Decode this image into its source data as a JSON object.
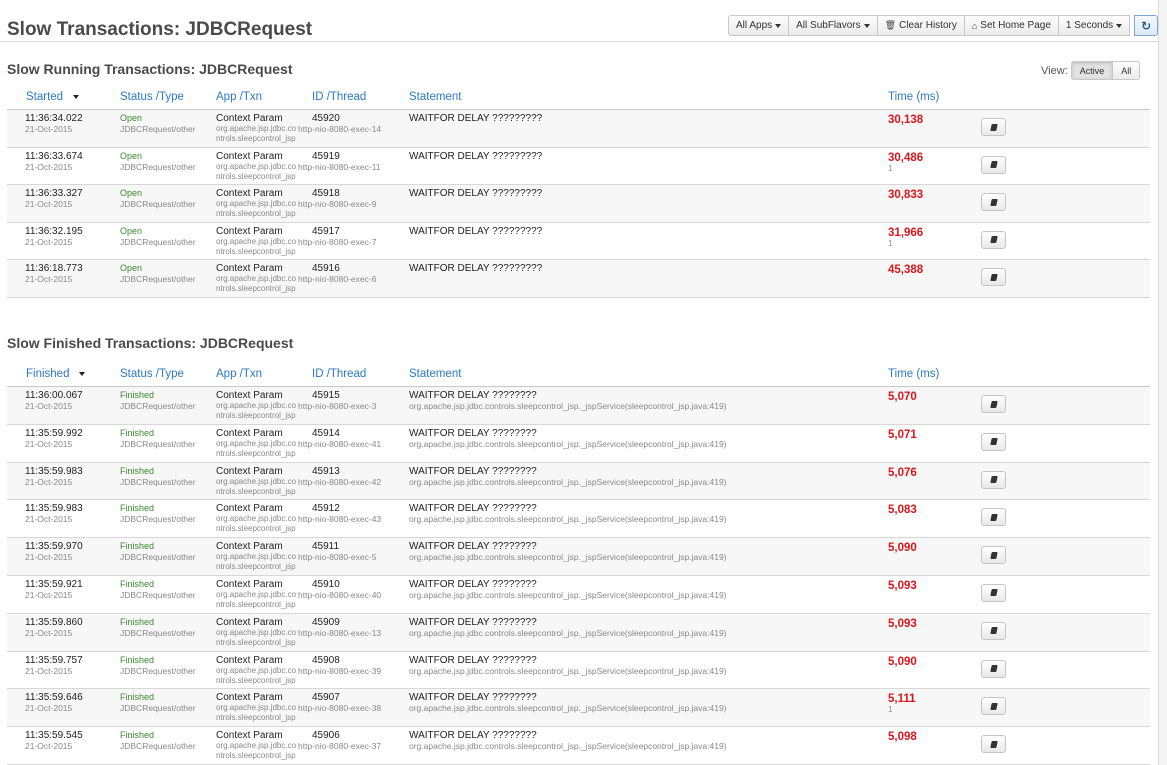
{
  "header": {
    "title": "Slow Transactions: JDBCRequest",
    "toolbar": {
      "apps_label": "All Apps",
      "subflavors_label": "All SubFlavors",
      "clear_label": "Clear History",
      "home_label": "Set Home Page",
      "interval_label": "1 Seconds"
    }
  },
  "running": {
    "title": "Slow Running Transactions: JDBCRequest",
    "view_label": "View:",
    "view_options": [
      "Active",
      "All"
    ],
    "columns": [
      "Started",
      "Status /Type",
      "App /Txn",
      "ID /Thread",
      "Statement",
      "Time (ms)"
    ],
    "rows": [
      {
        "time": "11:36:34.022",
        "date": "21-Oct-2015",
        "status": "Open",
        "type": "JDBCRequest/other",
        "app": "Context Param",
        "txn": "org.apache.jsp.jdbc.controls.sleepcontrol_jsp",
        "id": "45920",
        "thread": "http-nio-8080-exec-14",
        "statement": "WAITFOR DELAY ?????????",
        "ms": "30,138",
        "sub": ""
      },
      {
        "time": "11:36:33.674",
        "date": "21-Oct-2015",
        "status": "Open",
        "type": "JDBCRequest/other",
        "app": "Context Param",
        "txn": "org.apache.jsp.jdbc.controls.sleepcontrol_jsp",
        "id": "45919",
        "thread": "http-nio-8080-exec-11",
        "statement": "WAITFOR DELAY ?????????",
        "ms": "30,486",
        "sub": "1"
      },
      {
        "time": "11:36:33.327",
        "date": "21-Oct-2015",
        "status": "Open",
        "type": "JDBCRequest/other",
        "app": "Context Param",
        "txn": "org.apache.jsp.jdbc.controls.sleepcontrol_jsp",
        "id": "45918",
        "thread": "http-nio-8080-exec-9",
        "statement": "WAITFOR DELAY ?????????",
        "ms": "30,833",
        "sub": ""
      },
      {
        "time": "11:36:32.195",
        "date": "21-Oct-2015",
        "status": "Open",
        "type": "JDBCRequest/other",
        "app": "Context Param",
        "txn": "org.apache.jsp.jdbc.controls.sleepcontrol_jsp",
        "id": "45917",
        "thread": "http-nio-8080-exec-7",
        "statement": "WAITFOR DELAY ?????????",
        "ms": "31,966",
        "sub": "1"
      },
      {
        "time": "11:36:18.773",
        "date": "21-Oct-2015",
        "status": "Open",
        "type": "JDBCRequest/other",
        "app": "Context Param",
        "txn": "org.apache.jsp.jdbc.controls.sleepcontrol_jsp",
        "id": "45916",
        "thread": "http-nio-8080-exec-6",
        "statement": "WAITFOR DELAY ?????????",
        "ms": "45,388",
        "sub": ""
      }
    ]
  },
  "finished": {
    "title": "Slow Finished Transactions: JDBCRequest",
    "columns": [
      "Finished",
      "Status /Type",
      "App /Txn",
      "ID /Thread",
      "Statement",
      "Time (ms)"
    ],
    "rows": [
      {
        "time": "11:36:00.067",
        "date": "21-Oct-2015",
        "status": "Finished",
        "type": "JDBCRequest/other",
        "app": "Context Param",
        "txn": "org.apache.jsp.jdbc.controls.sleepcontrol_jsp",
        "id": "45915",
        "thread": "http-nio-8080-exec-3",
        "statement": "WAITFOR DELAY ????????",
        "stack": "org.apache.jsp.jdbc.controls.sleepcontrol_jsp._jspService(sleepcontrol_jsp.java:419)",
        "ms": "5,070",
        "sub": ""
      },
      {
        "time": "11:35:59.992",
        "date": "21-Oct-2015",
        "status": "Finished",
        "type": "JDBCRequest/other",
        "app": "Context Param",
        "txn": "org.apache.jsp.jdbc.controls.sleepcontrol_jsp",
        "id": "45914",
        "thread": "http-nio-8080-exec-41",
        "statement": "WAITFOR DELAY ????????",
        "stack": "org.apache.jsp.jdbc.controls.sleepcontrol_jsp._jspService(sleepcontrol_jsp.java:419)",
        "ms": "5,071",
        "sub": ""
      },
      {
        "time": "11:35:59.983",
        "date": "21-Oct-2015",
        "status": "Finished",
        "type": "JDBCRequest/other",
        "app": "Context Param",
        "txn": "org.apache.jsp.jdbc.controls.sleepcontrol_jsp",
        "id": "45913",
        "thread": "http-nio-8080-exec-42",
        "statement": "WAITFOR DELAY ????????",
        "stack": "org.apache.jsp.jdbc.controls.sleepcontrol_jsp._jspService(sleepcontrol_jsp.java:419)",
        "ms": "5,076",
        "sub": ""
      },
      {
        "time": "11:35:59.983",
        "date": "21-Oct-2015",
        "status": "Finished",
        "type": "JDBCRequest/other",
        "app": "Context Param",
        "txn": "org.apache.jsp.jdbc.controls.sleepcontrol_jsp",
        "id": "45912",
        "thread": "http-nio-8080-exec-43",
        "statement": "WAITFOR DELAY ????????",
        "stack": "org.apache.jsp.jdbc.controls.sleepcontrol_jsp._jspService(sleepcontrol_jsp.java:419)",
        "ms": "5,083",
        "sub": ""
      },
      {
        "time": "11:35:59.970",
        "date": "21-Oct-2015",
        "status": "Finished",
        "type": "JDBCRequest/other",
        "app": "Context Param",
        "txn": "org.apache.jsp.jdbc.controls.sleepcontrol_jsp",
        "id": "45911",
        "thread": "http-nio-8080-exec-5",
        "statement": "WAITFOR DELAY ????????",
        "stack": "org.apache.jsp.jdbc.controls.sleepcontrol_jsp._jspService(sleepcontrol_jsp.java:419)",
        "ms": "5,090",
        "sub": ""
      },
      {
        "time": "11:35:59.921",
        "date": "21-Oct-2015",
        "status": "Finished",
        "type": "JDBCRequest/other",
        "app": "Context Param",
        "txn": "org.apache.jsp.jdbc.controls.sleepcontrol_jsp",
        "id": "45910",
        "thread": "http-nio-8080-exec-40",
        "statement": "WAITFOR DELAY ????????",
        "stack": "org.apache.jsp.jdbc.controls.sleepcontrol_jsp._jspService(sleepcontrol_jsp.java:419)",
        "ms": "5,093",
        "sub": ""
      },
      {
        "time": "11:35:59.860",
        "date": "21-Oct-2015",
        "status": "Finished",
        "type": "JDBCRequest/other",
        "app": "Context Param",
        "txn": "org.apache.jsp.jdbc.controls.sleepcontrol_jsp",
        "id": "45909",
        "thread": "http-nio-8080-exec-13",
        "statement": "WAITFOR DELAY ????????",
        "stack": "org.apache.jsp.jdbc.controls.sleepcontrol_jsp._jspService(sleepcontrol_jsp.java:419)",
        "ms": "5,093",
        "sub": ""
      },
      {
        "time": "11:35:59.757",
        "date": "21-Oct-2015",
        "status": "Finished",
        "type": "JDBCRequest/other",
        "app": "Context Param",
        "txn": "org.apache.jsp.jdbc.controls.sleepcontrol_jsp",
        "id": "45908",
        "thread": "http-nio-8080-exec-39",
        "statement": "WAITFOR DELAY ????????",
        "stack": "org.apache.jsp.jdbc.controls.sleepcontrol_jsp._jspService(sleepcontrol_jsp.java:419)",
        "ms": "5,090",
        "sub": ""
      },
      {
        "time": "11:35:59.646",
        "date": "21-Oct-2015",
        "status": "Finished",
        "type": "JDBCRequest/other",
        "app": "Context Param",
        "txn": "org.apache.jsp.jdbc.controls.sleepcontrol_jsp",
        "id": "45907",
        "thread": "http-nio-8080-exec-38",
        "statement": "WAITFOR DELAY ????????",
        "stack": "org.apache.jsp.jdbc.controls.sleepcontrol_jsp._jspService(sleepcontrol_jsp.java:419)",
        "ms": "5,111",
        "sub": "1"
      },
      {
        "time": "11:35:59.545",
        "date": "21-Oct-2015",
        "status": "Finished",
        "type": "JDBCRequest/other",
        "app": "Context Param",
        "txn": "org.apache.jsp.jdbc.controls.sleepcontrol_jsp",
        "id": "45906",
        "thread": "http-nio-8080-exec-37",
        "statement": "WAITFOR DELAY ????????",
        "stack": "org.apache.jsp.jdbc.controls.sleepcontrol_jsp._jspService(sleepcontrol_jsp.java:419)",
        "ms": "5,098",
        "sub": ""
      }
    ]
  }
}
